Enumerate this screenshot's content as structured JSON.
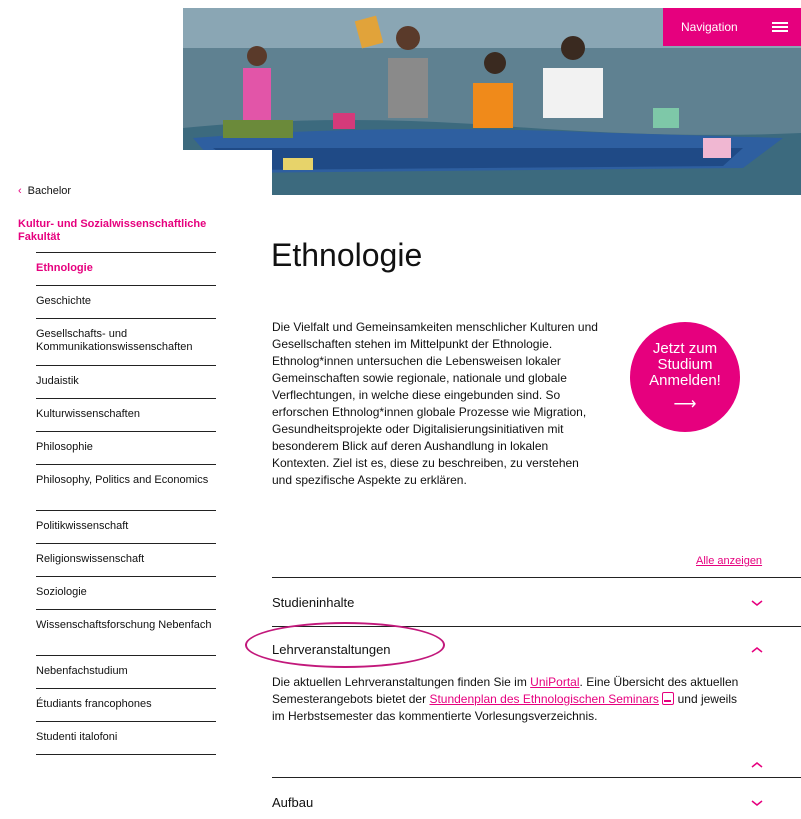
{
  "header": {
    "nav_label": "Navigation",
    "menu_icon": "hamburger-icon",
    "hero_alt": "people-in-boat-photo"
  },
  "sidebar": {
    "back_label": "Bachelor",
    "faculty": "Kultur- und Sozialwissenschaftliche Fakultät",
    "items": [
      {
        "label": "Ethnologie",
        "active": true
      },
      {
        "label": "Geschichte"
      },
      {
        "label": "Gesellschafts- und Kommunikationswissenschaften"
      },
      {
        "label": "Judaistik"
      },
      {
        "label": "Kulturwissenschaften"
      },
      {
        "label": "Philosophie"
      },
      {
        "label": "Philosophy, Politics and Economics"
      },
      {
        "label": "Politikwissenschaft"
      },
      {
        "label": "Religionswissenschaft"
      },
      {
        "label": "Soziologie"
      },
      {
        "label": "Wissenschaftsforschung Nebenfach"
      },
      {
        "label": "Nebenfachstudium"
      },
      {
        "label": "Étudiants francophones"
      },
      {
        "label": "Studenti italofoni"
      }
    ]
  },
  "main": {
    "title": "Ethnologie",
    "intro": "Die Vielfalt und Gemeinsamkeiten menschlicher Kulturen und Gesellschaften stehen im Mittelpunkt der Ethnologie. Ethnolog*innen untersuchen die Lebensweisen lokaler Gemeinschaften sowie regionale, nationale und globale Verflechtungen, in welche diese eingebunden sind. So erforschen Ethnolog*innen globale Prozesse wie Migration, Gesundheitsprojekte oder Digitalisierungsinitiativen mit besonderem Blick auf deren Aushandlung in lokalen Kontexten. Ziel ist es, diese zu beschreiben, zu verstehen und spezifische Aspekte zu erklären.",
    "cta": {
      "line1": "Jetzt zum",
      "line2": "Studium",
      "line3": "Anmelden!",
      "arrow": "⟶"
    },
    "show_all": "Alle anzeigen",
    "accordion": {
      "studieninhalte": "Studieninhalte",
      "lehrveranstaltungen": "Lehrveranstaltungen",
      "aufbau": "Aufbau",
      "lv_text1": "Die aktuellen Lehrveranstaltungen finden Sie im ",
      "lv_link1": "UniPortal",
      "lv_text2": ". Eine Übersicht des aktuellen Semesterangebots bietet der ",
      "lv_link2": "Stundenplan des Ethnologischen Seminars",
      "lv_text3": " und jeweils im Herbstsemester das kommentierte Vorlesungsverzeichnis."
    }
  },
  "colors": {
    "accent": "#e6007e",
    "annotation": "#c2187b"
  }
}
